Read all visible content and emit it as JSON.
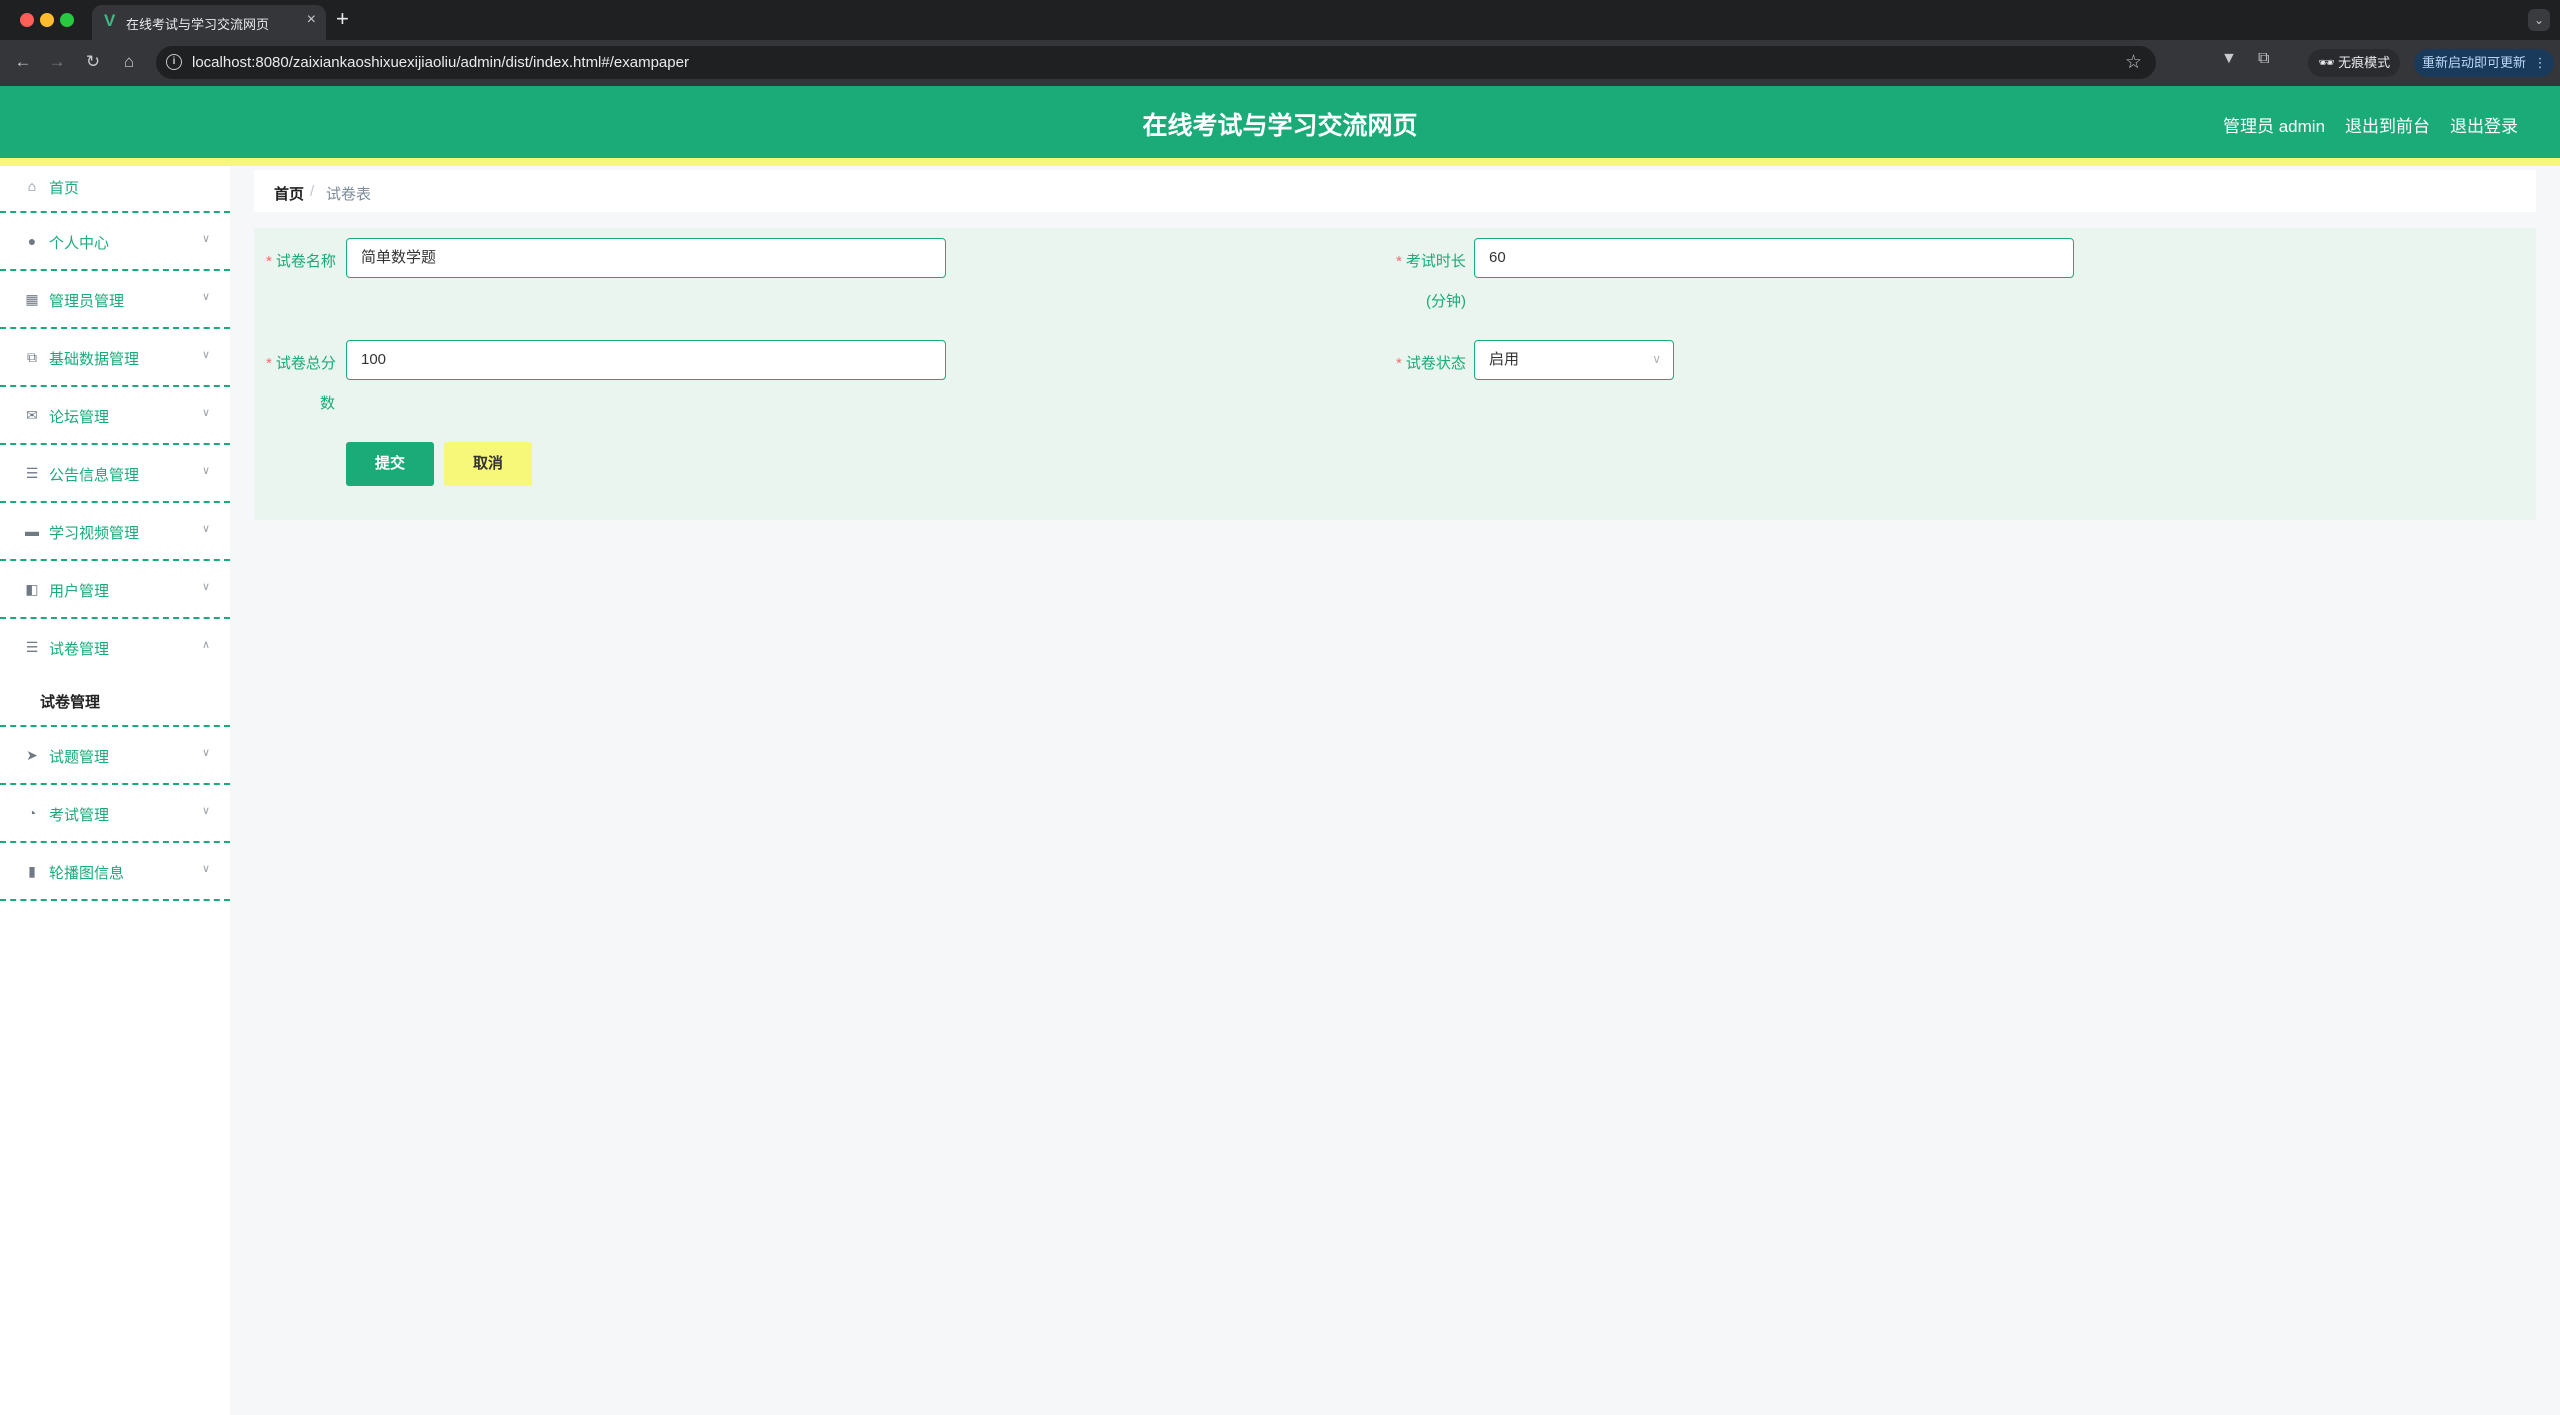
{
  "browser": {
    "tab_title": "在线考试与学习交流网页",
    "tab_close": "×",
    "new_tab": "+",
    "tab_menu": "⌄",
    "url": "localhost:8080/zaixiankaoshixuexijiaoliu/admin/dist/index.html#/exampaper",
    "incognito_label": "无痕模式",
    "update_label": "重新启动即可更新"
  },
  "header": {
    "title": "在线考试与学习交流网页",
    "admin_label": "管理员 admin",
    "front_link": "退出到前台",
    "logout_link": "退出登录"
  },
  "sidebar": {
    "items": [
      {
        "label": "首页",
        "icon": "home-icon"
      },
      {
        "label": "个人中心",
        "icon": "user-icon"
      },
      {
        "label": "管理员管理",
        "icon": "grid-icon"
      },
      {
        "label": "基础数据管理",
        "icon": "copy-icon"
      },
      {
        "label": "论坛管理",
        "icon": "mail-icon"
      },
      {
        "label": "公告信息管理",
        "icon": "list-icon"
      },
      {
        "label": "学习视频管理",
        "icon": "monitor-icon"
      },
      {
        "label": "用户管理",
        "icon": "users-icon"
      },
      {
        "label": "试卷管理",
        "icon": "list-icon",
        "expanded": true
      },
      {
        "label": "试题管理",
        "icon": "send-icon"
      },
      {
        "label": "考试管理",
        "icon": "gauge-icon"
      },
      {
        "label": "轮播图信息",
        "icon": "bar-chart-icon"
      }
    ],
    "submenu_label": "试卷管理"
  },
  "breadcrumb": {
    "home": "首页",
    "separator": "/",
    "current": "试卷表"
  },
  "form": {
    "required_mark": "*",
    "paper_name_label": "试卷名称",
    "paper_name_value": "简单数学题",
    "duration_label": "考试时长",
    "duration_label_2": "(分钟)",
    "duration_value": "60",
    "score_label": "试卷总分",
    "score_label_2": "数",
    "score_value": "100",
    "status_label": "试卷状态",
    "status_value": "启用",
    "submit_label": "提交",
    "cancel_label": "取消"
  },
  "colors": {
    "primary": "#1aab78",
    "accent": "#f7f779",
    "required": "#f56c6c"
  }
}
